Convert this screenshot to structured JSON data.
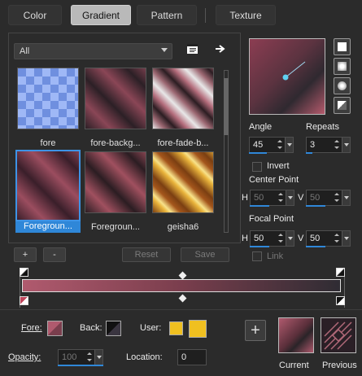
{
  "tabs": [
    {
      "label": "Color"
    },
    {
      "label": "Gradient",
      "active": true
    },
    {
      "label": "Pattern"
    },
    {
      "label": "Texture"
    }
  ],
  "category_dropdown": {
    "value": "All"
  },
  "gradients": [
    {
      "label": "fore"
    },
    {
      "label": "fore-backg..."
    },
    {
      "label": "fore-fade-b..."
    },
    {
      "label": "Foregroun...",
      "selected": true
    },
    {
      "label": "Foregroun..."
    },
    {
      "label": "geisha6"
    }
  ],
  "actions": {
    "add": "+",
    "remove": "-",
    "reset": "Reset",
    "save": "Save"
  },
  "angle": {
    "label": "Angle",
    "value": "45"
  },
  "repeats": {
    "label": "Repeats",
    "value": "3"
  },
  "invert": {
    "label": "Invert",
    "checked": false
  },
  "center_point": {
    "label": "Center Point",
    "h_label": "H",
    "h_value": "50",
    "v_label": "V",
    "v_value": "50"
  },
  "focal_point": {
    "label": "Focal Point",
    "h_label": "H",
    "h_value": "50",
    "v_label": "V",
    "v_value": "50"
  },
  "link": {
    "label": "Link"
  },
  "fore": {
    "label": "Fore:",
    "color": "#b05a6e"
  },
  "back": {
    "label": "Back:",
    "color": "#2f2c33"
  },
  "user": {
    "label": "User:",
    "colors": [
      "#f0c020",
      "#f0c020"
    ]
  },
  "opacity": {
    "label": "Opacity:",
    "value": "100"
  },
  "location": {
    "label": "Location:",
    "value": "0"
  },
  "current": {
    "label": "Current"
  },
  "previous": {
    "label": "Previous"
  },
  "add_big": "+"
}
